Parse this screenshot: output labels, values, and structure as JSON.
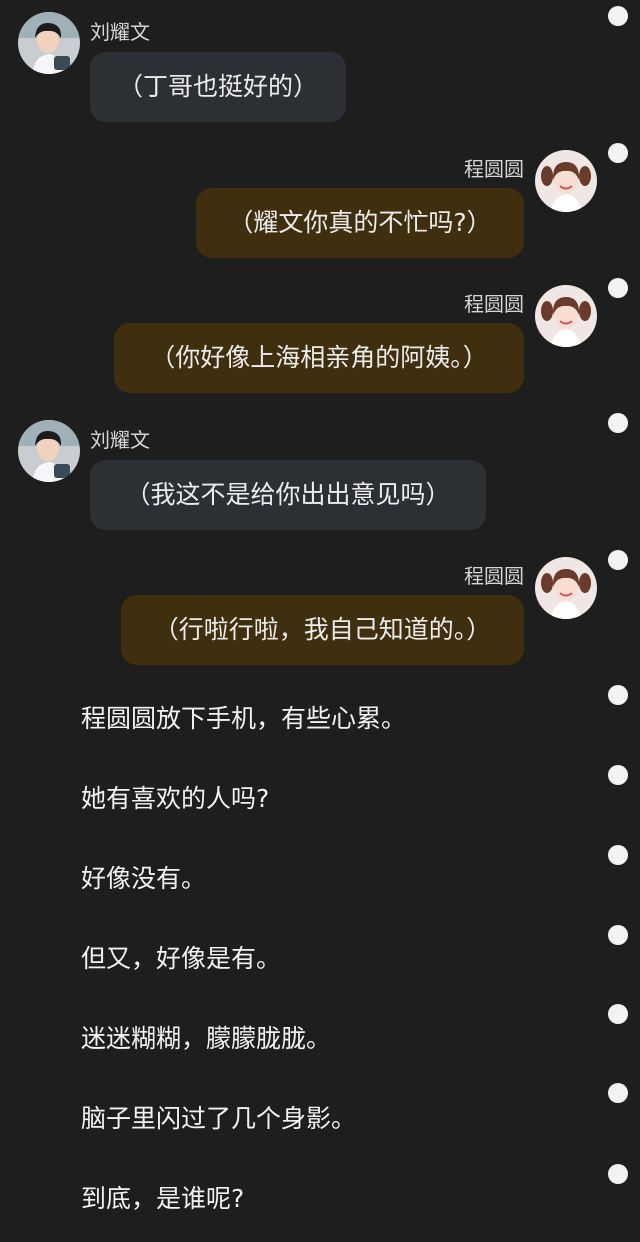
{
  "characters": {
    "liu": {
      "name": "刘耀文",
      "bubble_color": "#2c3034"
    },
    "cheng": {
      "name": "程圆圆",
      "bubble_color": "#3f2f0e"
    }
  },
  "messages": [
    {
      "speaker": "liu",
      "side": "left",
      "text": "（丁哥也挺好的）"
    },
    {
      "speaker": "cheng",
      "side": "right",
      "text": "（耀文你真的不忙吗?）"
    },
    {
      "speaker": "cheng",
      "side": "right",
      "text": "（你好像上海相亲角的阿姨。）"
    },
    {
      "speaker": "liu",
      "side": "left",
      "text": "（我这不是给你出出意见吗）"
    },
    {
      "speaker": "cheng",
      "side": "right",
      "text": "（行啦行啦，我自己知道的。）"
    }
  ],
  "narration": [
    "程圆圆放下手机，有些心累。",
    "她有喜欢的人吗?",
    "好像没有。",
    "但又，好像是有。",
    "迷迷糊糊，朦朦胧胧。",
    "脑子里闪过了几个身影。",
    "到底，是谁呢?"
  ],
  "icons": {
    "avatar_liu": "avatar-boy-white-shirt",
    "avatar_cheng": "avatar-girl-pigtails",
    "paragraph_marker": "white-dot"
  }
}
